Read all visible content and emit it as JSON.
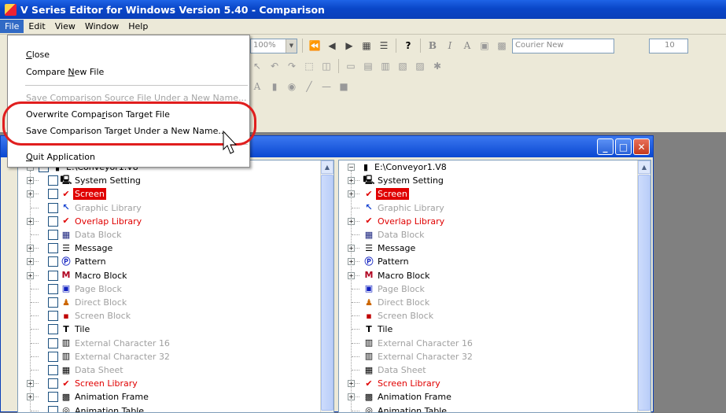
{
  "window": {
    "title": "V Series Editor for Windows Version 5.40 - Comparison"
  },
  "menubar": [
    "File",
    "Edit",
    "View",
    "Window",
    "Help"
  ],
  "file_menu": {
    "items": [
      {
        "label": "Close",
        "accel": "C",
        "disabled": false
      },
      {
        "label": "Compare New File",
        "accel": "N",
        "disabled": false
      },
      {
        "label": "Save Comparison Source File Under a New Name...",
        "disabled": true
      },
      {
        "label": "Overwrite Comparison Target File",
        "accel": "r",
        "disabled": false
      },
      {
        "label": "Save Comparison Target Under a New Name...",
        "disabled": false
      },
      {
        "label": "Quit Application",
        "accel": "Q",
        "disabled": false
      }
    ]
  },
  "toolbar": {
    "zoom": "100%",
    "font": "Courier New",
    "font_size": "10"
  },
  "tree": {
    "left_root": "E:\\Conveyor1.V8",
    "right_root": "E:\\Conveyor1.V8",
    "items": [
      {
        "label": "System Setting",
        "style": "normal",
        "icon": "monitor-icon",
        "expandable": true
      },
      {
        "label": "Screen",
        "style": "selected",
        "icon": "screen-icon",
        "expandable": true
      },
      {
        "label": "Graphic Library",
        "style": "gray",
        "icon": "graphic-library-icon",
        "expandable": false
      },
      {
        "label": "Overlap Library",
        "style": "red",
        "icon": "overlap-library-icon",
        "expandable": true
      },
      {
        "label": "Data Block",
        "style": "gray",
        "icon": "data-block-icon",
        "expandable": false
      },
      {
        "label": "Message",
        "style": "normal",
        "icon": "message-icon",
        "expandable": true
      },
      {
        "label": "Pattern",
        "style": "normal",
        "icon": "pattern-icon",
        "expandable": true
      },
      {
        "label": "Macro Block",
        "style": "normal",
        "icon": "macro-block-icon",
        "expandable": true
      },
      {
        "label": "Page Block",
        "style": "gray",
        "icon": "page-block-icon",
        "expandable": false
      },
      {
        "label": "Direct Block",
        "style": "gray",
        "icon": "direct-block-icon",
        "expandable": false
      },
      {
        "label": "Screen Block",
        "style": "gray",
        "icon": "screen-block-icon",
        "expandable": false
      },
      {
        "label": "Tile",
        "style": "normal",
        "icon": "tile-icon",
        "expandable": false
      },
      {
        "label": "External Character 16",
        "style": "gray",
        "icon": "ext-char-16-icon",
        "expandable": false
      },
      {
        "label": "External Character 32",
        "style": "gray",
        "icon": "ext-char-32-icon",
        "expandable": false
      },
      {
        "label": "Data Sheet",
        "style": "gray",
        "icon": "data-sheet-icon",
        "expandable": false
      },
      {
        "label": "Screen Library",
        "style": "red",
        "icon": "screen-library-icon",
        "expandable": true
      },
      {
        "label": "Animation Frame",
        "style": "normal",
        "icon": "animation-frame-icon",
        "expandable": true
      },
      {
        "label": "Animation Table",
        "style": "normal",
        "icon": "animation-table-icon",
        "expandable": false
      }
    ]
  },
  "colors": {
    "title_blue": "#0a46c8",
    "diff_red": "#e00000",
    "highlight_red": "#e01e1e"
  }
}
